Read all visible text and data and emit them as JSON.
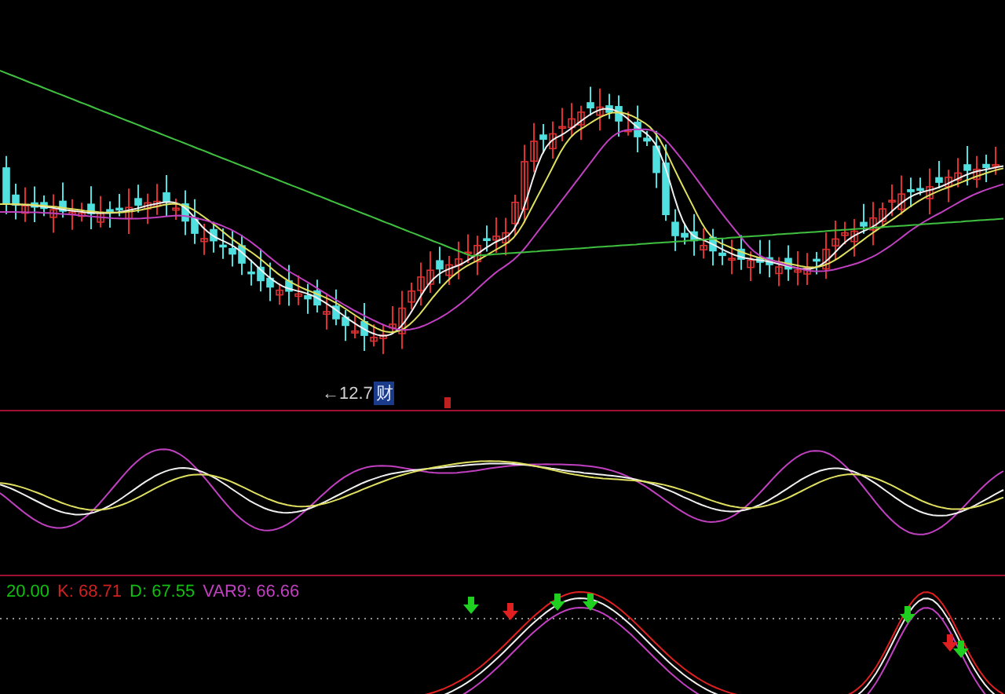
{
  "main_panel": {
    "low_label": "←12.7",
    "badge": "财"
  },
  "indicator_panel": {
    "readings": [
      {
        "text": "20.00",
        "color": "#10c010"
      },
      {
        "text": "K: 68.71",
        "color": "#d02020"
      },
      {
        "text": "D: 67.55",
        "color": "#10c010"
      },
      {
        "text": "VAR9: 66.66",
        "color": "#c040c0"
      }
    ]
  }
}
